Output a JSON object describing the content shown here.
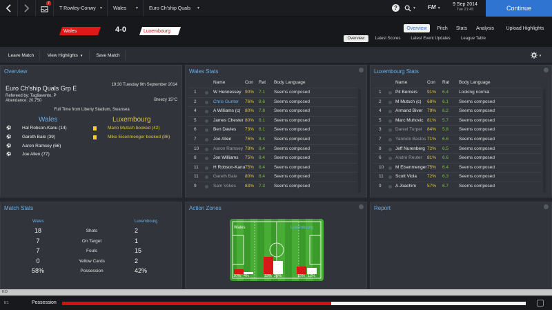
{
  "topbar": {
    "manager": "T Rowley-Conwy",
    "team": "Wales",
    "competition": "Euro Ch'ship Quals",
    "inbox_count": "7",
    "fm_label": "FM",
    "date": "9 Sep 2014",
    "time": "Tue 21:45",
    "continue_label": "Continue"
  },
  "header": {
    "home_team": "Wales",
    "away_team": "Luxembourg",
    "score": "4-0",
    "home_color": "#e01818",
    "away_color": "#ffffff"
  },
  "tabs": [
    "Overview",
    "Pitch",
    "Stats",
    "Analysis",
    "Upload Highlights"
  ],
  "subtabs": [
    "Overview",
    "Latest Scores",
    "Latest Event Updates",
    "League Table"
  ],
  "toolbar": {
    "leave": "Leave Match",
    "highlights": "View Highlights",
    "save": "Save Match"
  },
  "overview": {
    "title": "Overview",
    "competition": "Euro Ch'ship Quals Grp E",
    "datetime": "19:30 Tuesday 9th September 2014",
    "referee": "Refereed by: Tagliavento, P",
    "attendance": "Attendance: 20,750",
    "weather": "Breezy 15°C",
    "fulltime": "Full Time from Liberty Stadium, Swansea",
    "home_team": "Wales",
    "away_team": "Luxembourg",
    "home_events": [
      "Hal Robson-Kanu (14)",
      "Gareth Bale (39)",
      "Aaron Ramsey (66)",
      "Joe Allen (77)"
    ],
    "away_events": [
      "Mario Mutsch booked (42)",
      "Mike Eisenmenger booked (86)"
    ]
  },
  "wales_stats": {
    "title": "Wales Stats",
    "headers": [
      "Name",
      "Con",
      "Rat",
      "Body Language"
    ],
    "rows": [
      {
        "n": "1",
        "name": "W Hennessey",
        "con": "90%",
        "rat": "7.1",
        "bl": "Seems composed",
        "style": "normal"
      },
      {
        "n": "2",
        "name": "Chris Gunter",
        "con": "76%",
        "rat": "8.6",
        "bl": "Seems composed",
        "style": "blue"
      },
      {
        "n": "4",
        "name": "A Williams (c)",
        "con": "80%",
        "rat": "7.8",
        "bl": "Seems composed",
        "style": "normal"
      },
      {
        "n": "5",
        "name": "James Chester",
        "con": "80%",
        "rat": "8.1",
        "bl": "Seems composed",
        "style": "normal"
      },
      {
        "n": "6",
        "name": "Ben Davies",
        "con": "73%",
        "rat": "8.1",
        "bl": "Seems composed",
        "style": "normal"
      },
      {
        "n": "7",
        "name": "Joe Allen",
        "con": "76%",
        "rat": "8.4",
        "bl": "Seems composed",
        "style": "normal"
      },
      {
        "n": "10",
        "name": "Aaron Ramsey",
        "con": "78%",
        "rat": "8.4",
        "bl": "Seems composed",
        "style": "grey"
      },
      {
        "n": "8",
        "name": "Jon Williams",
        "con": "75%",
        "rat": "8.4",
        "bl": "Seems composed",
        "style": "normal"
      },
      {
        "n": "11",
        "name": "H Robson-Kanu",
        "con": "75%",
        "rat": "8.4",
        "bl": "Seems composed",
        "style": "normal"
      },
      {
        "n": "11",
        "name": "Gareth Bale",
        "con": "80%",
        "rat": "8.4",
        "bl": "Seems composed",
        "style": "grey"
      },
      {
        "n": "9",
        "name": "Sam Vokes",
        "con": "83%",
        "rat": "7.3",
        "bl": "Seems composed",
        "style": "grey"
      }
    ]
  },
  "lux_stats": {
    "title": "Luxembourg Stats",
    "headers": [
      "Name",
      "Con",
      "Rat",
      "Body Language"
    ],
    "rows": [
      {
        "n": "1",
        "name": "Pit Berners",
        "con": "91%",
        "rat": "6.4",
        "bl": "Looking normal",
        "style": "normal"
      },
      {
        "n": "2",
        "name": "M Mutsch (c)",
        "con": "68%",
        "rat": "6.1",
        "bl": "Seems composed",
        "style": "normal"
      },
      {
        "n": "4",
        "name": "Armand Biver",
        "con": "79%",
        "rat": "6.2",
        "bl": "Seems composed",
        "style": "normal"
      },
      {
        "n": "5",
        "name": "Marc Muhovic",
        "con": "81%",
        "rat": "5.7",
        "bl": "Seems composed",
        "style": "normal"
      },
      {
        "n": "3",
        "name": "Daniel Turpel",
        "con": "84%",
        "rat": "5.8",
        "bl": "Seems composed",
        "style": "grey"
      },
      {
        "n": "7",
        "name": "Yannick Bastos",
        "con": "71%",
        "rat": "6.6",
        "bl": "Seems composed",
        "style": "grey"
      },
      {
        "n": "8",
        "name": "Jeff Nurenberg",
        "con": "72%",
        "rat": "6.5",
        "bl": "Seems composed",
        "style": "normal"
      },
      {
        "n": "6",
        "name": "André Reuter",
        "con": "81%",
        "rat": "6.6",
        "bl": "Seems composed",
        "style": "grey"
      },
      {
        "n": "10",
        "name": "M Eisenmenger",
        "con": "75%",
        "rat": "6.4",
        "bl": "Seems composed",
        "style": "normal"
      },
      {
        "n": "11",
        "name": "Scott Viola",
        "con": "72%",
        "rat": "6.3",
        "bl": "Seems composed",
        "style": "normal"
      },
      {
        "n": "9",
        "name": "A Joachim",
        "con": "57%",
        "rat": "6.7",
        "bl": "Seems composed",
        "style": "normal"
      }
    ]
  },
  "match_stats": {
    "title": "Match Stats",
    "home": "Wales",
    "away": "Luxembourg",
    "rows": [
      {
        "h": "18",
        "label": "Shots",
        "a": "2"
      },
      {
        "h": "7",
        "label": "On Target",
        "a": "1"
      },
      {
        "h": "7",
        "label": "Fouls",
        "a": "15"
      },
      {
        "h": "0",
        "label": "Yellow Cards",
        "a": "2"
      },
      {
        "h": "58%",
        "label": "Possession",
        "a": "42%"
      }
    ]
  },
  "action_zones": {
    "title": "Action Zones",
    "home": "Wales",
    "away": "Luxembourg",
    "home_pcts": [
      "10%",
      "4%",
      "33%",
      "26%"
    ],
    "away_pcts": [
      "15%",
      "12%"
    ],
    "home_values": [
      10,
      4,
      33,
      26
    ],
    "away_values": [
      15,
      12
    ]
  },
  "report": {
    "title": "Report"
  },
  "bottombar": {
    "possession_label": "Possession",
    "home_possession": 0.58,
    "left_code": "E1"
  },
  "scroll_label": "KO"
}
